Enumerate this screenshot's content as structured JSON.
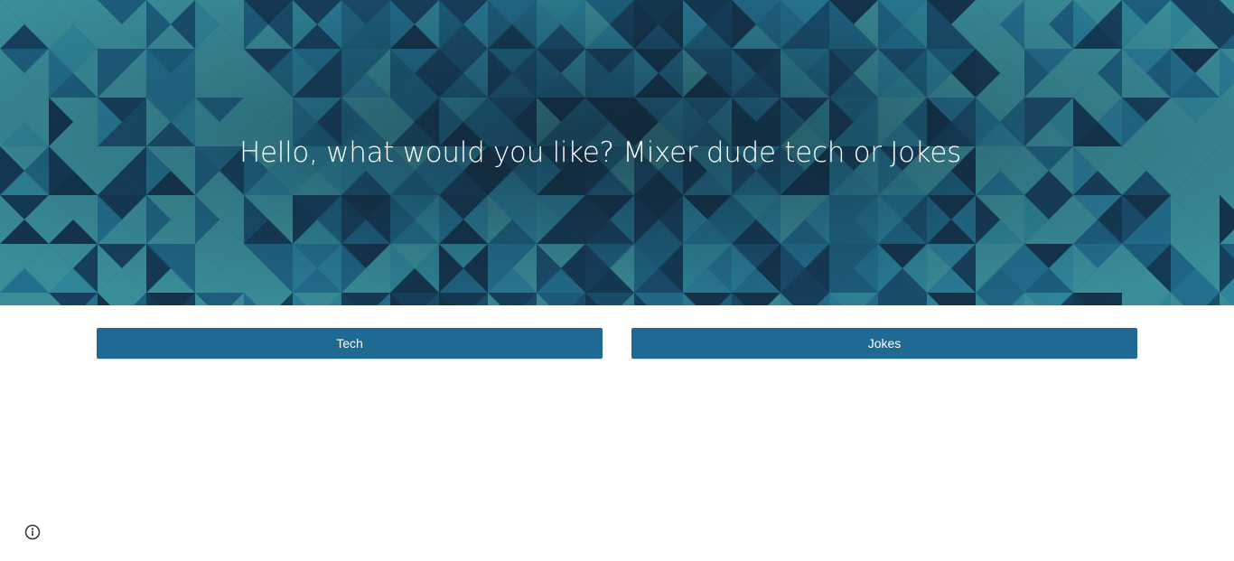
{
  "banner": {
    "title": "Hello, what would you like? Mixer dude tech or Jokes"
  },
  "choices": [
    {
      "label": "Tech"
    },
    {
      "label": "Jokes"
    }
  ],
  "colors": {
    "banner_base": "#1b4f6b",
    "button_bg": "#1e6a93",
    "button_text": "#ffffff",
    "page_bg": "#ffffff"
  },
  "icons": {
    "info": "info-icon"
  }
}
